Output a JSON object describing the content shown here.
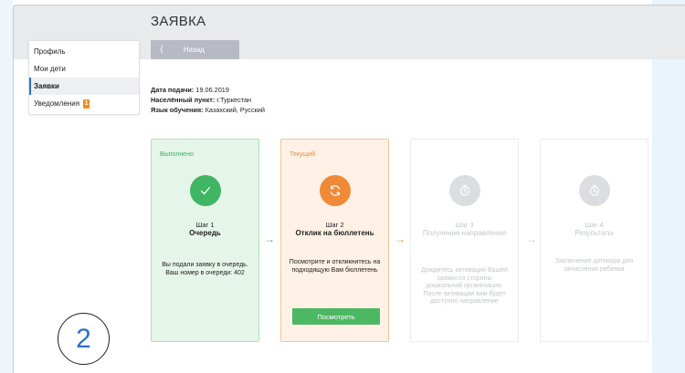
{
  "page": {
    "title": "ЗАЯВКА"
  },
  "toolbar": {
    "back_label": "Назад"
  },
  "sidebar": {
    "items": [
      {
        "label": "Профиль"
      },
      {
        "label": "Мои дети"
      },
      {
        "label": "Заявки",
        "active": true
      },
      {
        "label": "Уведомления",
        "badge": "1"
      }
    ]
  },
  "application": {
    "date_label": "Дата подачи:",
    "date_value": " 19.06.2019",
    "locality_label": "Населённый пункт:",
    "locality_value": " г.Туркестан",
    "language_label": "Язык обучения:",
    "language_value": " Казахский, Русский"
  },
  "steps": [
    {
      "status": "Выполнено",
      "number": "Шаг 1",
      "name": "Очередь",
      "icon": "check-icon",
      "description": "Вы подали заявку в очередь. Ваш номер в очереди: 402"
    },
    {
      "status": "Текущий",
      "number": "Шаг 2",
      "name": "Отклик на бюллетень",
      "icon": "refresh-icon",
      "description": "Посмотрите и откликнитесь на подходящую Вам бюллетень",
      "button_label": "Посмотреть"
    },
    {
      "number": "Шаг 3",
      "name": "Получение направления",
      "icon": "clock-icon",
      "description": "Дождитесь активации Вашей заявки со стороны дошкольной организации. После активации вам будет доступно направление"
    },
    {
      "number": "Шаг 4",
      "name": "Результаты",
      "icon": "clock-icon",
      "description": "Заключение договора для зачисления ребенка"
    }
  ],
  "annotation": {
    "number": "2"
  },
  "colors": {
    "done": "#40b563",
    "current": "#f08a36",
    "pending": "#dcdde1",
    "active_indicator": "#2e6fd8",
    "annotation_number": "#2c6ed4"
  }
}
